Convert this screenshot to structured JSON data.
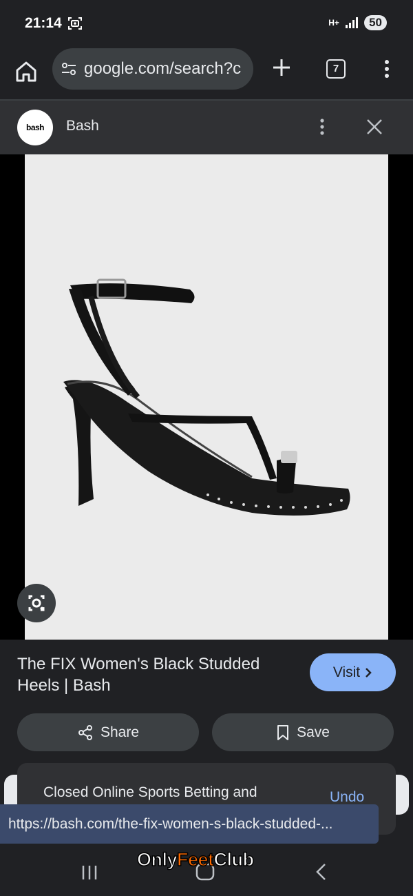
{
  "status_bar": {
    "time": "21:14",
    "network": "H+",
    "battery": "50"
  },
  "browser": {
    "url": "google.com/search?c",
    "tab_count": "7"
  },
  "source": {
    "logo_text": "bash",
    "name": "Bash"
  },
  "product": {
    "title": "The FIX Women's Black Studded Heels | Bash",
    "visit_label": "Visit"
  },
  "actions": {
    "share_label": "Share",
    "save_label": "Save"
  },
  "snackbar": {
    "message": "Closed Online Sports Betting and",
    "undo_label": "Undo"
  },
  "link_preview": {
    "url": "https://bash.com/the-fix-women-s-black-studded-..."
  },
  "watermark": {
    "part1": "Only",
    "part2": "Feet",
    "part3": "Club"
  },
  "colors": {
    "background": "#202124",
    "accent": "#8ab4f8",
    "surface": "#3c4043",
    "tooltip": "#3b4a6b"
  }
}
